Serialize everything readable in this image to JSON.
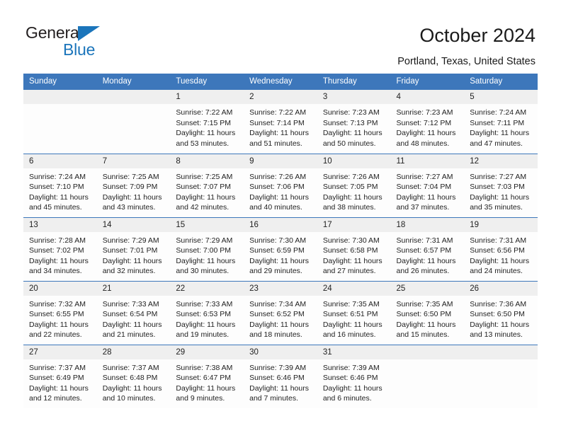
{
  "brand": {
    "name_part1": "General",
    "name_part2": "Blue",
    "triangle_color": "#1b75bb"
  },
  "header": {
    "title": "October 2024",
    "location": "Portland, Texas, United States"
  },
  "colors": {
    "header_bar": "#3d77bb",
    "date_band": "#efefef",
    "divider": "#3d77bb"
  },
  "weekday_headers": [
    "Sunday",
    "Monday",
    "Tuesday",
    "Wednesday",
    "Thursday",
    "Friday",
    "Saturday"
  ],
  "weeks": [
    [
      {
        "day": "",
        "sunrise": "",
        "sunset": "",
        "daylight_line1": "",
        "daylight_line2": ""
      },
      {
        "day": "",
        "sunrise": "",
        "sunset": "",
        "daylight_line1": "",
        "daylight_line2": ""
      },
      {
        "day": "1",
        "sunrise": "Sunrise: 7:22 AM",
        "sunset": "Sunset: 7:15 PM",
        "daylight_line1": "Daylight: 11 hours",
        "daylight_line2": "and 53 minutes."
      },
      {
        "day": "2",
        "sunrise": "Sunrise: 7:22 AM",
        "sunset": "Sunset: 7:14 PM",
        "daylight_line1": "Daylight: 11 hours",
        "daylight_line2": "and 51 minutes."
      },
      {
        "day": "3",
        "sunrise": "Sunrise: 7:23 AM",
        "sunset": "Sunset: 7:13 PM",
        "daylight_line1": "Daylight: 11 hours",
        "daylight_line2": "and 50 minutes."
      },
      {
        "day": "4",
        "sunrise": "Sunrise: 7:23 AM",
        "sunset": "Sunset: 7:12 PM",
        "daylight_line1": "Daylight: 11 hours",
        "daylight_line2": "and 48 minutes."
      },
      {
        "day": "5",
        "sunrise": "Sunrise: 7:24 AM",
        "sunset": "Sunset: 7:11 PM",
        "daylight_line1": "Daylight: 11 hours",
        "daylight_line2": "and 47 minutes."
      }
    ],
    [
      {
        "day": "6",
        "sunrise": "Sunrise: 7:24 AM",
        "sunset": "Sunset: 7:10 PM",
        "daylight_line1": "Daylight: 11 hours",
        "daylight_line2": "and 45 minutes."
      },
      {
        "day": "7",
        "sunrise": "Sunrise: 7:25 AM",
        "sunset": "Sunset: 7:09 PM",
        "daylight_line1": "Daylight: 11 hours",
        "daylight_line2": "and 43 minutes."
      },
      {
        "day": "8",
        "sunrise": "Sunrise: 7:25 AM",
        "sunset": "Sunset: 7:07 PM",
        "daylight_line1": "Daylight: 11 hours",
        "daylight_line2": "and 42 minutes."
      },
      {
        "day": "9",
        "sunrise": "Sunrise: 7:26 AM",
        "sunset": "Sunset: 7:06 PM",
        "daylight_line1": "Daylight: 11 hours",
        "daylight_line2": "and 40 minutes."
      },
      {
        "day": "10",
        "sunrise": "Sunrise: 7:26 AM",
        "sunset": "Sunset: 7:05 PM",
        "daylight_line1": "Daylight: 11 hours",
        "daylight_line2": "and 38 minutes."
      },
      {
        "day": "11",
        "sunrise": "Sunrise: 7:27 AM",
        "sunset": "Sunset: 7:04 PM",
        "daylight_line1": "Daylight: 11 hours",
        "daylight_line2": "and 37 minutes."
      },
      {
        "day": "12",
        "sunrise": "Sunrise: 7:27 AM",
        "sunset": "Sunset: 7:03 PM",
        "daylight_line1": "Daylight: 11 hours",
        "daylight_line2": "and 35 minutes."
      }
    ],
    [
      {
        "day": "13",
        "sunrise": "Sunrise: 7:28 AM",
        "sunset": "Sunset: 7:02 PM",
        "daylight_line1": "Daylight: 11 hours",
        "daylight_line2": "and 34 minutes."
      },
      {
        "day": "14",
        "sunrise": "Sunrise: 7:29 AM",
        "sunset": "Sunset: 7:01 PM",
        "daylight_line1": "Daylight: 11 hours",
        "daylight_line2": "and 32 minutes."
      },
      {
        "day": "15",
        "sunrise": "Sunrise: 7:29 AM",
        "sunset": "Sunset: 7:00 PM",
        "daylight_line1": "Daylight: 11 hours",
        "daylight_line2": "and 30 minutes."
      },
      {
        "day": "16",
        "sunrise": "Sunrise: 7:30 AM",
        "sunset": "Sunset: 6:59 PM",
        "daylight_line1": "Daylight: 11 hours",
        "daylight_line2": "and 29 minutes."
      },
      {
        "day": "17",
        "sunrise": "Sunrise: 7:30 AM",
        "sunset": "Sunset: 6:58 PM",
        "daylight_line1": "Daylight: 11 hours",
        "daylight_line2": "and 27 minutes."
      },
      {
        "day": "18",
        "sunrise": "Sunrise: 7:31 AM",
        "sunset": "Sunset: 6:57 PM",
        "daylight_line1": "Daylight: 11 hours",
        "daylight_line2": "and 26 minutes."
      },
      {
        "day": "19",
        "sunrise": "Sunrise: 7:31 AM",
        "sunset": "Sunset: 6:56 PM",
        "daylight_line1": "Daylight: 11 hours",
        "daylight_line2": "and 24 minutes."
      }
    ],
    [
      {
        "day": "20",
        "sunrise": "Sunrise: 7:32 AM",
        "sunset": "Sunset: 6:55 PM",
        "daylight_line1": "Daylight: 11 hours",
        "daylight_line2": "and 22 minutes."
      },
      {
        "day": "21",
        "sunrise": "Sunrise: 7:33 AM",
        "sunset": "Sunset: 6:54 PM",
        "daylight_line1": "Daylight: 11 hours",
        "daylight_line2": "and 21 minutes."
      },
      {
        "day": "22",
        "sunrise": "Sunrise: 7:33 AM",
        "sunset": "Sunset: 6:53 PM",
        "daylight_line1": "Daylight: 11 hours",
        "daylight_line2": "and 19 minutes."
      },
      {
        "day": "23",
        "sunrise": "Sunrise: 7:34 AM",
        "sunset": "Sunset: 6:52 PM",
        "daylight_line1": "Daylight: 11 hours",
        "daylight_line2": "and 18 minutes."
      },
      {
        "day": "24",
        "sunrise": "Sunrise: 7:35 AM",
        "sunset": "Sunset: 6:51 PM",
        "daylight_line1": "Daylight: 11 hours",
        "daylight_line2": "and 16 minutes."
      },
      {
        "day": "25",
        "sunrise": "Sunrise: 7:35 AM",
        "sunset": "Sunset: 6:50 PM",
        "daylight_line1": "Daylight: 11 hours",
        "daylight_line2": "and 15 minutes."
      },
      {
        "day": "26",
        "sunrise": "Sunrise: 7:36 AM",
        "sunset": "Sunset: 6:50 PM",
        "daylight_line1": "Daylight: 11 hours",
        "daylight_line2": "and 13 minutes."
      }
    ],
    [
      {
        "day": "27",
        "sunrise": "Sunrise: 7:37 AM",
        "sunset": "Sunset: 6:49 PM",
        "daylight_line1": "Daylight: 11 hours",
        "daylight_line2": "and 12 minutes."
      },
      {
        "day": "28",
        "sunrise": "Sunrise: 7:37 AM",
        "sunset": "Sunset: 6:48 PM",
        "daylight_line1": "Daylight: 11 hours",
        "daylight_line2": "and 10 minutes."
      },
      {
        "day": "29",
        "sunrise": "Sunrise: 7:38 AM",
        "sunset": "Sunset: 6:47 PM",
        "daylight_line1": "Daylight: 11 hours",
        "daylight_line2": "and 9 minutes."
      },
      {
        "day": "30",
        "sunrise": "Sunrise: 7:39 AM",
        "sunset": "Sunset: 6:46 PM",
        "daylight_line1": "Daylight: 11 hours",
        "daylight_line2": "and 7 minutes."
      },
      {
        "day": "31",
        "sunrise": "Sunrise: 7:39 AM",
        "sunset": "Sunset: 6:46 PM",
        "daylight_line1": "Daylight: 11 hours",
        "daylight_line2": "and 6 minutes."
      },
      {
        "day": "",
        "sunrise": "",
        "sunset": "",
        "daylight_line1": "",
        "daylight_line2": ""
      },
      {
        "day": "",
        "sunrise": "",
        "sunset": "",
        "daylight_line1": "",
        "daylight_line2": ""
      }
    ]
  ]
}
